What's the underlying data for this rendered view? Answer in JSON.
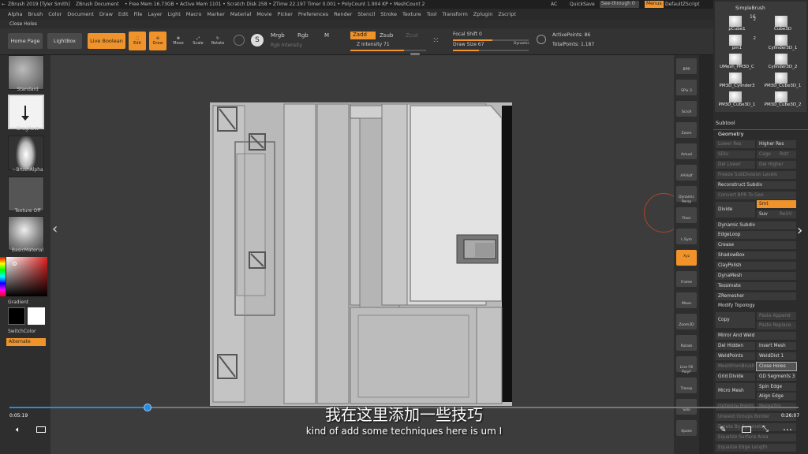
{
  "titlebar": {
    "app": "ZBrush 2019 [Tyler Smith]",
    "doc": "ZBrush Document",
    "stats": "• Free Mem 16.73GB • Active Mem 1101 • Scratch Disk 258 • ZTime 22.197 Timer 0.001 • PolyCount 1.904 KP • MeshCount 2",
    "ac": "AC",
    "quicksave": "QuickSave",
    "seethrough": "See-through",
    "seethrough_val": "0",
    "menus": "Menus",
    "script": "DefaultZScript"
  },
  "menubar": [
    "Alpha",
    "Brush",
    "Color",
    "Document",
    "Draw",
    "Edit",
    "File",
    "Layer",
    "Light",
    "Macro",
    "Marker",
    "Material",
    "Movie",
    "Picker",
    "Preferences",
    "Render",
    "Stencil",
    "Stroke",
    "Texture",
    "Tool",
    "Transform",
    "Zplugin",
    "Zscript"
  ],
  "brush_title": "Close Holes",
  "toolbar": {
    "home": "Home Page",
    "lightbox": "LightBox",
    "liveboolean": "Live Boolean",
    "edit": "Edit",
    "draw": "Draw",
    "move": "Move",
    "scale": "Scale",
    "rotate": "Rotate",
    "mrgb": "Mrgb",
    "rgb": "Rgb",
    "m": "M",
    "rgb_intensity": "Rgb Intensity",
    "zadd": "Zadd",
    "zsub": "Zsub",
    "zcut": "Zcut",
    "z_intensity": "Z Intensity 71",
    "focal_shift": "Focal Shift 0",
    "draw_size": "Draw Size 67",
    "dynamic": "Dynamic",
    "active_points": "ActivePoints: 86",
    "total_points": "TotalPoints: 1.187"
  },
  "leftshelf": {
    "standard": "Standard",
    "dragrect": "DragRect",
    "brushalpha": "~BrushAlpha",
    "texture": "Texture Off",
    "material": "BasicMaterial",
    "gradient": "Gradient",
    "switchcolor": "SwitchColor",
    "alternate": "Alternate"
  },
  "rtools": [
    "BPR",
    "SPix 3",
    "Scroll",
    "Zoom",
    "Actual",
    "AAHalf",
    "Dynamic Persp",
    "Floor",
    "L.Sym",
    "Xyz",
    "Frame",
    "Move",
    "Zoom3D",
    "Rotate",
    "Line Fill PolyF",
    "Transp",
    "Solo",
    "Xpose"
  ],
  "subtools": {
    "top_label": "SimpleBrush",
    "top_count": "16",
    "items": [
      {
        "name": "pCube1",
        "count": "2"
      },
      {
        "name": "Cube3D",
        "count": ""
      },
      {
        "name": "pm1",
        "count": "2"
      },
      {
        "name": "Cylinder3D_1",
        "count": ""
      },
      {
        "name": "UMesh_PM3D_C",
        "count": ""
      },
      {
        "name": "Cylinder3D_2",
        "count": ""
      },
      {
        "name": "PM3D_Cylinder3",
        "count": ""
      },
      {
        "name": "PM3D_Cube3D_1",
        "count": ""
      },
      {
        "name": "PM3D_Cube3D_1",
        "count": ""
      },
      {
        "name": "PM3D_Cube3D_2",
        "count": ""
      }
    ]
  },
  "panel": {
    "subtool": "Subtool",
    "geometry": "Geometry",
    "lower_res": "Lower Res",
    "higher_res": "Higher Res",
    "sdiv": "SDiv",
    "cage": "Cage",
    "rstr": "Rstr",
    "del_lower": "Del Lower",
    "del_higher": "Del Higher",
    "freeze": "Freeze SubDivision Levels",
    "reconstruct": "Reconstruct Subdiv",
    "convert_bpr": "Convert BPR To Geo",
    "divide": "Divide",
    "smt": "Smt",
    "suv": "Suv",
    "reuv": "ReUV",
    "dynamic_subdiv": "Dynamic Subdiv",
    "edgeloop": "EdgeLoop",
    "crease": "Crease",
    "shadowbox": "ShadowBox",
    "claypolish": "ClayPolish",
    "dynamesh": "DynaMesh",
    "tessimate": "Tessimate",
    "zremesher": "ZRemesher",
    "modify_topology": "Modify Topology",
    "copy": "Copy",
    "paste_append": "Paste Append",
    "paste_replace": "Paste Replace",
    "mirror_weld": "Mirror And Weld",
    "del_hidden": "Del Hidden",
    "insert_mesh": "Insert Mesh",
    "weldpoints": "WeldPoints",
    "welddist": "WeldDist 1",
    "meshfrombrush": "MeshFromBrush",
    "close_holes": "Close Holes",
    "grid_divide": "Grid Divide",
    "gd_segments": "GD Segments 3",
    "micro_mesh": "Micro Mesh",
    "spin_edge": "Spin Edge",
    "align_edge": "Align Edge",
    "optimize_points": "Optimize Points",
    "merge_tris": "MergeTris",
    "unweld_groups": "Unweld Groups Border",
    "delete_by_symmetry": "Delete By Symmetry",
    "equalize_surface": "Equalize Surface Area",
    "equalize_edge": "Equalize Edge Length"
  },
  "video": {
    "current_time": "0:05:19",
    "total_time": "0:26:07",
    "progress": 0.175,
    "subtitle_cn": "我在这里添加一些技巧",
    "subtitle_en": "kind of add some techniques here is um I"
  }
}
